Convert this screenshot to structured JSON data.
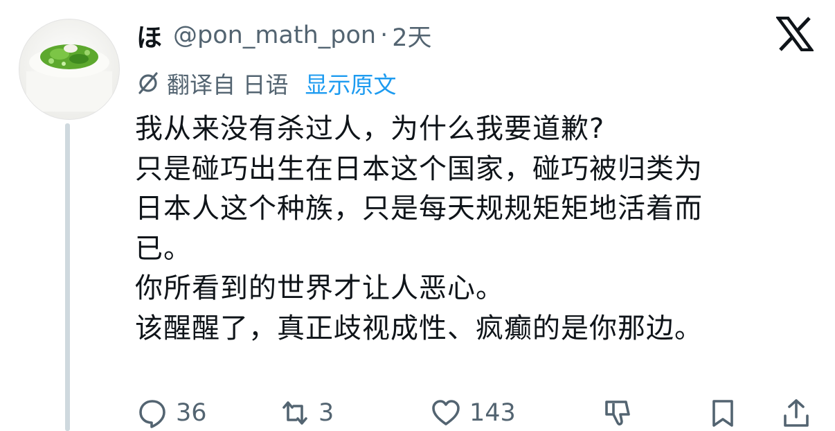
{
  "tweet": {
    "author_name": "ほ",
    "handle": "@pon_math_pon",
    "separator": "·",
    "time": "2天",
    "translated_from": "翻译自 日语",
    "show_original": "显示原文",
    "body_lines": [
      "我从来没有杀过人，为什么我要道歉?",
      "只是碰巧出生在日本这个国家，碰巧被归类为",
      "日本人这个种族，只是每天规规矩矩地活着而",
      "已。",
      "你所看到的世界才让人恶心。",
      "该醒醒了，真正歧视成性、疯癫的是你那边。"
    ]
  },
  "actions": {
    "reply_count": "36",
    "repost_count": "3",
    "like_count": "143"
  },
  "icons": {
    "brand": "x-logo",
    "translate": "translate-icon",
    "reply": "reply-icon",
    "repost": "repost-icon",
    "like": "heart-icon",
    "dislike": "dislike-icon",
    "bookmark": "bookmark-icon",
    "share": "share-icon"
  },
  "colors": {
    "text": "#0f1419",
    "secondary": "#536471",
    "link": "#1d9bf0"
  }
}
